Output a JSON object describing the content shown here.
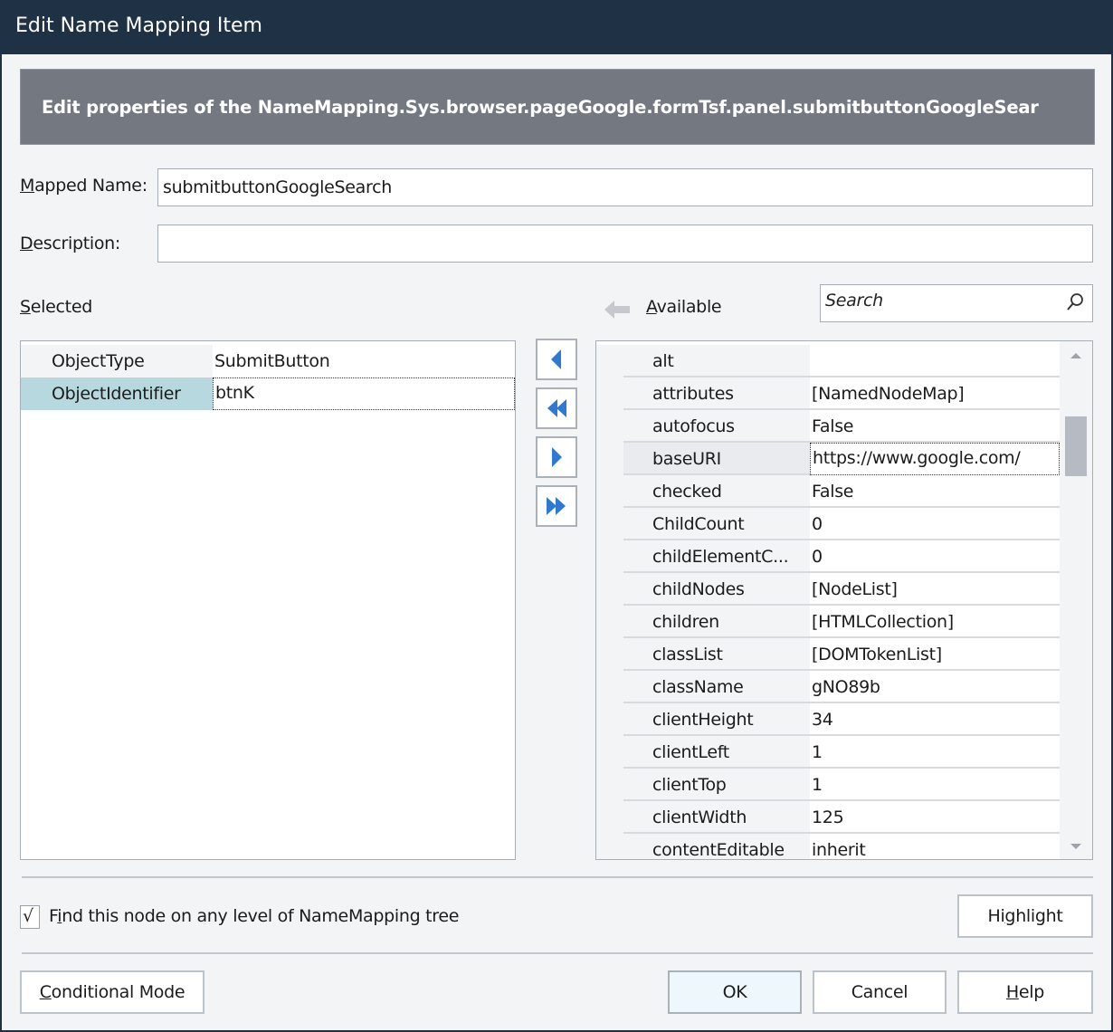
{
  "window": {
    "title": "Edit Name Mapping Item"
  },
  "banner": {
    "text": "Edit properties of the NameMapping.Sys.browser.pageGoogle.formTsf.panel.submitbuttonGoogleSear"
  },
  "form": {
    "mapped_name_label": "Mapped Name:",
    "mapped_name_value": "submitbuttonGoogleSearch",
    "description_label": "Description:",
    "description_value": ""
  },
  "selected": {
    "label": "Selected",
    "rows": [
      {
        "name": "ObjectType",
        "value": "SubmitButton"
      },
      {
        "name": "ObjectIdentifier",
        "value": "btnK"
      }
    ]
  },
  "available": {
    "label": "Available",
    "search_placeholder": "Search",
    "scroll_position": 0.1,
    "rows": [
      {
        "name": "alt",
        "value": ""
      },
      {
        "name": "attributes",
        "value": "[NamedNodeMap]"
      },
      {
        "name": "autofocus",
        "value": "False"
      },
      {
        "name": "baseURI",
        "value": "https://www.google.com/"
      },
      {
        "name": "checked",
        "value": "False"
      },
      {
        "name": "ChildCount",
        "value": "0"
      },
      {
        "name": "childElementC...",
        "value": "0"
      },
      {
        "name": "childNodes",
        "value": "[NodeList]"
      },
      {
        "name": "children",
        "value": "[HTMLCollection]"
      },
      {
        "name": "classList",
        "value": "[DOMTokenList]"
      },
      {
        "name": "className",
        "value": "gNO89b"
      },
      {
        "name": "clientHeight",
        "value": "34"
      },
      {
        "name": "clientLeft",
        "value": "1"
      },
      {
        "name": "clientTop",
        "value": "1"
      },
      {
        "name": "clientWidth",
        "value": "125"
      },
      {
        "name": "contentEditable",
        "value": "inherit"
      }
    ]
  },
  "transfer_buttons": [
    {
      "icon": "arrow-left-icon",
      "tooltip": ""
    },
    {
      "icon": "double-arrow-left-icon",
      "tooltip": ""
    },
    {
      "icon": "arrow-right-icon",
      "tooltip": ""
    },
    {
      "icon": "double-arrow-right-icon",
      "tooltip": ""
    }
  ],
  "options": {
    "find_any_level_label": "Find this node on any level of NameMapping tree",
    "find_any_level_checked": true,
    "highlight_label": "Highlight"
  },
  "footer": {
    "conditional_mode_label": "Conditional Mode",
    "ok_label": "OK",
    "cancel_label": "Cancel",
    "help_label": "Help"
  },
  "colors": {
    "titlebar": "#1f3245",
    "banner": "#737881",
    "selected_row": "#b8d8e0",
    "focused_row": "#e9ebee",
    "arrow_blue": "#2f79d2",
    "ok_button": "#eef7fb"
  }
}
